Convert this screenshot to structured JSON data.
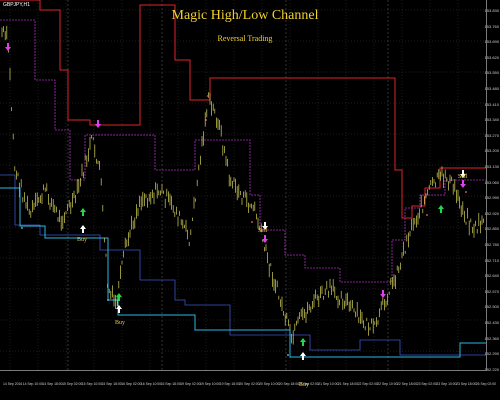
{
  "window": {
    "symbol": "GBPJPY,H1",
    "title": "Magic High/Low Channel",
    "subtitle": "Reversal Trading"
  },
  "annotations": {
    "buy_1": "Buy",
    "buy_2": "Buy",
    "buy_3": "Buy",
    "sell_1": "Sell",
    "sell_2": "Sell"
  },
  "price_axis": [
    "153.830",
    "153.760",
    "153.690",
    "153.620",
    "153.550",
    "153.480",
    "153.410",
    "153.340",
    "153.270",
    "153.200",
    "153.130",
    "153.060",
    "152.990",
    "152.920",
    "152.850",
    "152.780",
    "152.710",
    "152.640",
    "152.570",
    "152.500",
    "152.430",
    "152.360",
    "152.290",
    "152.220"
  ],
  "time_axis": [
    "14 Sep 2016",
    "14 Sep 10:00",
    "14 Sep 18:00",
    "15 Sep 02:00",
    "15 Sep 10:00",
    "15 Sep 18:00",
    "16 Sep 02:00",
    "16 Sep 10:00",
    "16 Sep 18:00",
    "19 Sep 02:00",
    "19 Sep 10:00",
    "19 Sep 18:00",
    "20 Sep 02:00",
    "20 Sep 10:00",
    "20 Sep 18:00",
    "21 Sep 02:00",
    "21 Sep 10:00",
    "21 Sep 18:00",
    "22 Sep 02:00",
    "22 Sep 10:00",
    "22 Sep 18:00",
    "23 Sep 02:00",
    "23 Sep 10:00",
    "23 Sep 18:00",
    "26 Sep 02:00"
  ],
  "colors": {
    "background": "#000000",
    "candle": "#d8d35a",
    "outer_high": "#e0242a",
    "inner_high": "#b02cc0",
    "outer_low": "#2ab7e6",
    "inner_low": "#3a55c8",
    "grid": "#3a3a3a",
    "buy_arrow": "#22d84a",
    "sell_arrow": "#e040e8",
    "signal_arrow": "#ffffff",
    "title": "#f2d22e"
  },
  "icons": {
    "buy_signal": "up-arrow-icon",
    "sell_signal": "down-arrow-icon"
  }
}
